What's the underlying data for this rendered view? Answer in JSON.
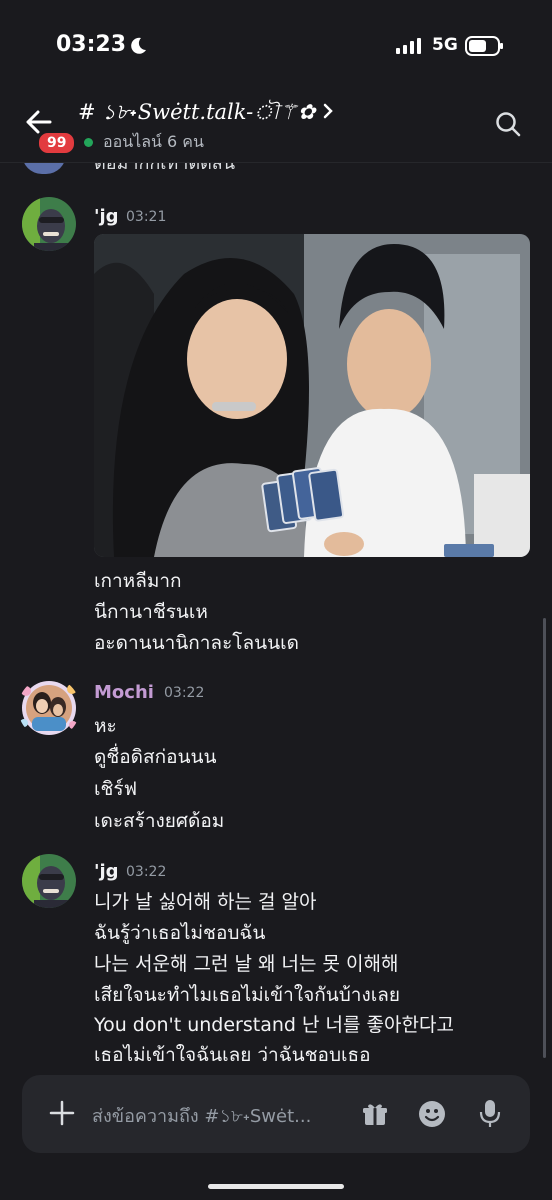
{
  "status_bar": {
    "time": "03:23",
    "network": "5G"
  },
  "header": {
    "badge_count": "99",
    "channel_name": "# ১৮˖Swėtt.talk-ৗ⚚✿",
    "online_text": "ออนไลน์ 6 คน"
  },
  "partial_message": {
    "text": "ต่อมาก็ก็เท่าตัดสิน"
  },
  "messages": [
    {
      "author": "'jg",
      "time": "03:21",
      "author_color": "#f2f3f5",
      "has_image": true,
      "lines": [
        "เกาหลีมาก",
        "นีกานาชีรนเห",
        "อะดานนานิกาละโลนนเด"
      ]
    },
    {
      "author": "Mochi",
      "time": "03:22",
      "author_color": "#c39bd3",
      "lines": [
        "หะ",
        "ดูชื่อดิสก่อนนน",
        "เชิร์ฟ",
        "เดะสร้างยศด้อม"
      ]
    },
    {
      "author": "'jg",
      "time": "03:22",
      "author_color": "#f2f3f5",
      "lines": [
        "니가 날 싫어해 하는 걸 알아",
        "ฉันรู้ว่าเธอไม่ชอบฉัน",
        "나는 서운해 그런 날 왜 너는 못 이해해",
        "เสียใจนะทำไมเธอไม่เข้าใจกันบ้างเลย",
        "You don't understand 난 너를 좋아한다고",
        "เธอไม่เข้าใจฉันเลย ว่าฉันชอบเธอ"
      ]
    }
  ],
  "composer": {
    "placeholder": "ส่งข้อความถึง #১৮˖Swėt..."
  },
  "icons": [
    "moon-icon",
    "signal-icon",
    "battery-icon",
    "back-arrow-icon",
    "chevron-right-icon",
    "search-icon",
    "plus-icon",
    "gift-icon",
    "emoji-icon",
    "microphone-icon"
  ]
}
